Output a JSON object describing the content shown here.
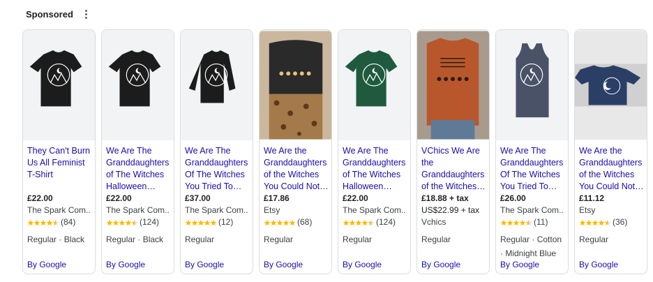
{
  "section": {
    "title": "Sponsored",
    "more_icon": "more-vert-icon"
  },
  "colors": {
    "link": "#1a0dab",
    "star": "#fbbc04",
    "border": "#dadce0"
  },
  "products": [
    {
      "title": "They Can't Burn Us All Feminist T-Shirt",
      "price": "£22.00",
      "alt_price": "",
      "merchant": "The Spark Com..",
      "stars": 4.5,
      "reviews": "(84)",
      "attrs": "Regular · Black",
      "link": "By Google",
      "garment": "tee",
      "color": "#1c1c1c"
    },
    {
      "title": "We Are The Granddaughters of The Witches Halloween…",
      "price": "£22.00",
      "alt_price": "",
      "merchant": "The Spark Com..",
      "stars": 4.5,
      "reviews": "(124)",
      "attrs": "Regular · Black",
      "link": "By Google",
      "garment": "tee",
      "color": "#1c1c1c"
    },
    {
      "title": "We Are The Granddaughters Of The Witches You Tried To…",
      "price": "£37.00",
      "alt_price": "",
      "merchant": "The Spark Com..",
      "stars": 5,
      "reviews": "(12)",
      "attrs": "Regular",
      "link": "By Google",
      "garment": "sweater",
      "color": "#1c1c1c"
    },
    {
      "title": "We Are the Granddaughters of the Witches You Could Not…",
      "price": "£17.86",
      "alt_price": "",
      "merchant": "Etsy",
      "stars": 5,
      "reviews": "(68)",
      "attrs": "Regular",
      "link": "By Google",
      "garment": "model-tee",
      "color": "#2a2a2a"
    },
    {
      "title": "We Are The Granddaughters of The Witches Halloween…",
      "price": "£22.00",
      "alt_price": "",
      "merchant": "The Spark Com..",
      "stars": 4.5,
      "reviews": "(124)",
      "attrs": "Regular",
      "link": "By Google",
      "garment": "tee",
      "color": "#1f5a3f"
    },
    {
      "title": "VChics We Are the Granddaughters of the Witches…",
      "price": "£18.88 + tax",
      "alt_price": "US$22.99 + tax",
      "merchant": "Vchics",
      "stars": 0,
      "reviews": "",
      "attrs": "Regular",
      "link": "By Google",
      "garment": "sweatshirt",
      "color": "#b9572c"
    },
    {
      "title": "We Are The Granddaughters Of The Witches You Tried To…",
      "price": "£26.00",
      "alt_price": "",
      "merchant": "The Spark Com..",
      "stars": 4.5,
      "reviews": "(11)",
      "attrs": "Regular · Cotton · Midnight Blue",
      "link": "By Google",
      "garment": "tank",
      "color": "#4a5268"
    },
    {
      "title": "We Are the Granddaughters of the Witches You Could Not…",
      "price": "£11.12",
      "alt_price": "",
      "merchant": "Etsy",
      "stars": 4.5,
      "reviews": "(36)",
      "attrs": "Regular",
      "link": "By Google",
      "garment": "flat-tee",
      "color": "#2b3f66"
    }
  ]
}
